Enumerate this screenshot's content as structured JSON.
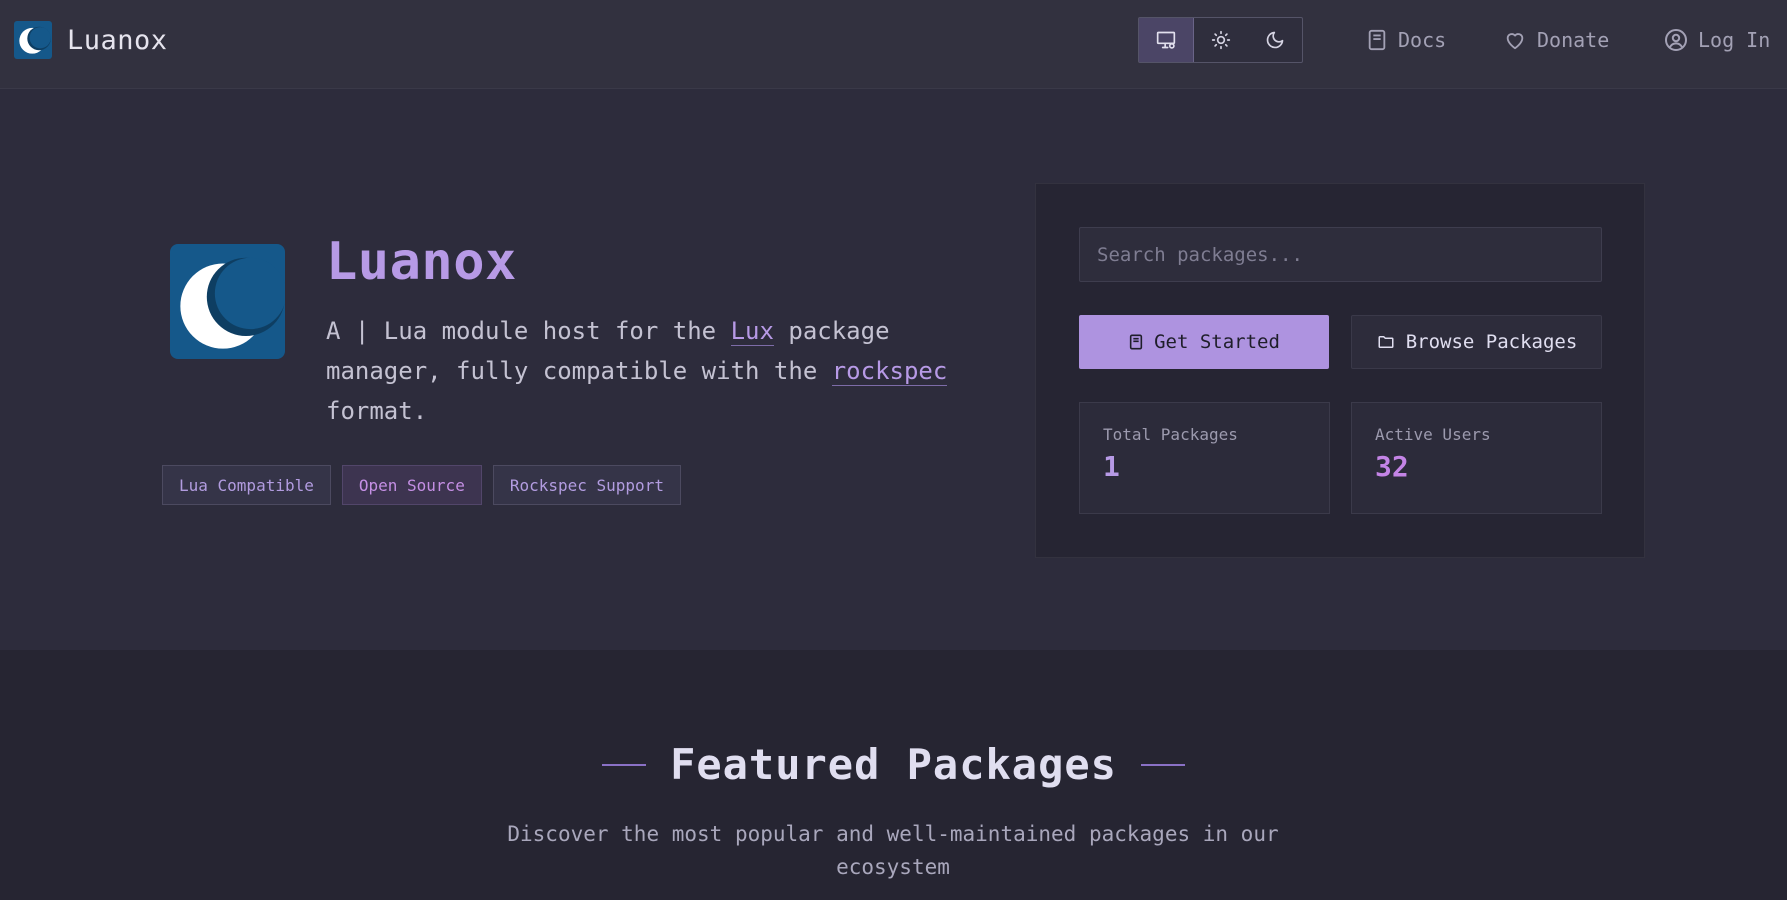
{
  "nav": {
    "brand": "Luanox",
    "theme": [
      "system",
      "light",
      "dark"
    ],
    "docs": "Docs",
    "donate": "Donate",
    "login": "Log In"
  },
  "hero": {
    "title": "Luanox",
    "desc_1": "A | Lua module host for the ",
    "lux": "Lux",
    "desc_2": " package manager, fully compatible with the ",
    "rockspec": "rockspec",
    "desc_3": " format.",
    "badges": [
      "Lua Compatible",
      "Open Source",
      "Rockspec Support"
    ]
  },
  "panel": {
    "search_placeholder": "Search packages...",
    "get_started": "Get Started",
    "browse": "Browse Packages",
    "stats": [
      {
        "label": "Total Packages",
        "value": "1"
      },
      {
        "label": "Active Users",
        "value": "32"
      }
    ]
  },
  "featured": {
    "title": "Featured Packages",
    "subtitle": "Discover the most popular and well-maintained packages in our ecosystem"
  },
  "colors": {
    "accent": "#b79ae6",
    "accent_pink": "#c484e6",
    "logo_bg": "#15588a"
  },
  "icons": [
    "logo-moon",
    "monitor-icon",
    "sun-icon",
    "moon-icon",
    "book-icon",
    "heart-icon",
    "user-icon",
    "folder-icon"
  ]
}
